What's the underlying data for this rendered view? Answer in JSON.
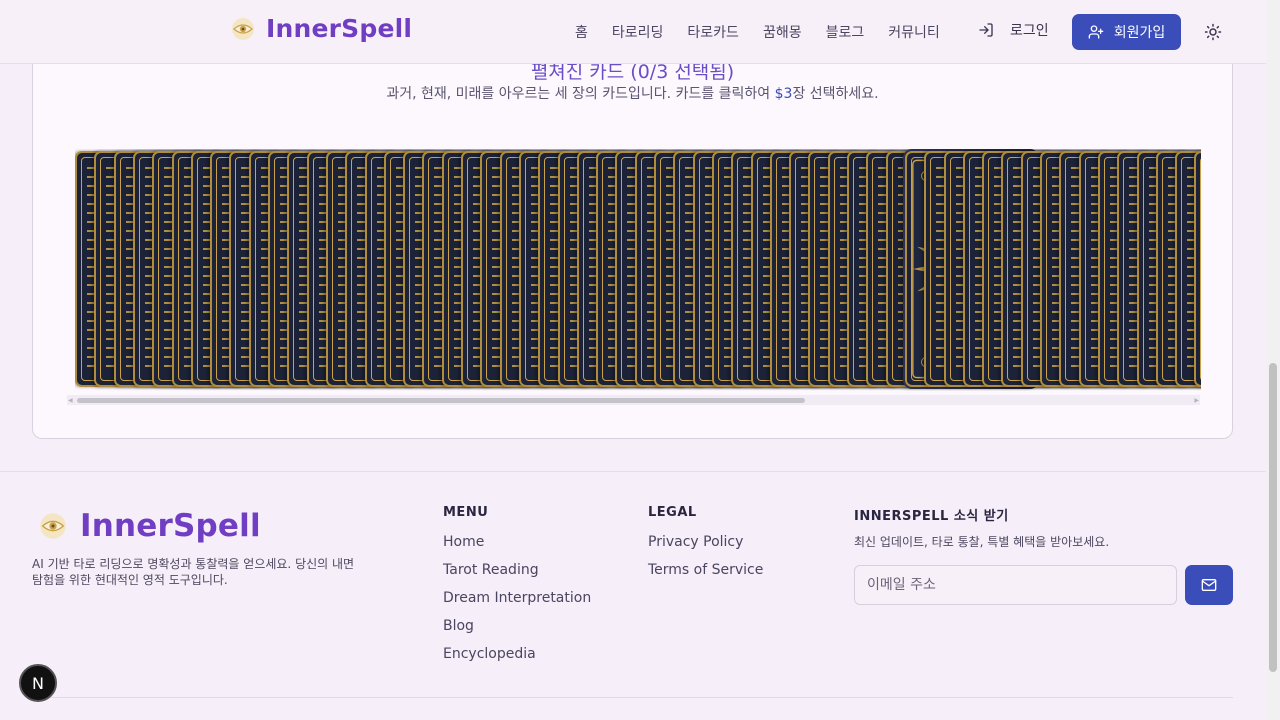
{
  "header": {
    "brand": "InnerSpell",
    "nav": [
      "홈",
      "타로리딩",
      "타로카드",
      "꿈해몽",
      "블로그",
      "커뮤니티"
    ],
    "login_label": "로그인",
    "signup_label": "회원가입"
  },
  "reading": {
    "title": "펼쳐진 카드 (0/3 선택됨)",
    "subtitle_before": "과거, 현재, 미래를 아우르는 세 장의 카드입니다. 카드를 클릭하여 ",
    "subtitle_accent": "$3",
    "subtitle_after": "장 선택하세요."
  },
  "footer": {
    "brand": "InnerSpell",
    "description": "AI 기반 타로 리딩으로 명확성과 통찰력을 얻으세요. 당신의 내면 탐험을 위한 현대적인 영적 도구입니다.",
    "menu_title": "MENU",
    "menu_links": [
      "Home",
      "Tarot Reading",
      "Dream Interpretation",
      "Blog",
      "Encyclopedia"
    ],
    "legal_title": "LEGAL",
    "legal_links": [
      "Privacy Policy",
      "Terms of Service"
    ],
    "newsletter_title": "INNERSPELL 소식 받기",
    "newsletter_sub": "최신 업데이트, 타로 통찰, 특별 혜택을 받아보세요.",
    "email_placeholder": "이메일 주소"
  },
  "badge": "N",
  "colors": {
    "brand": "#6f3ec2",
    "primary": "#3a4db8",
    "card_bg": "#1c2338",
    "card_gold": "#c9a24a"
  }
}
